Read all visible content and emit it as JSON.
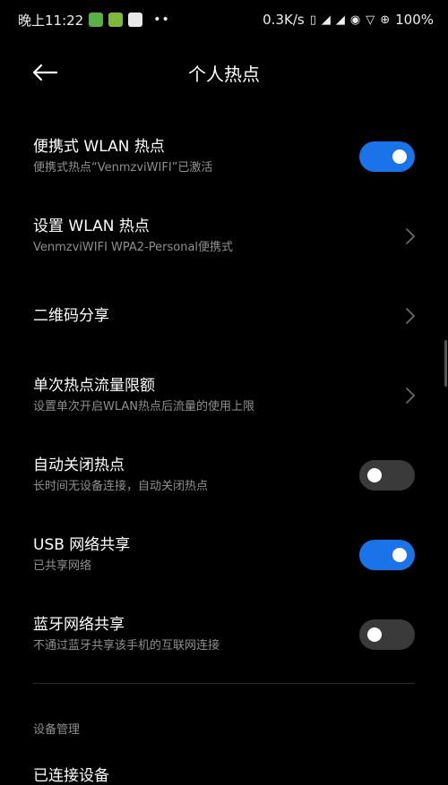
{
  "status_bar": {
    "time": "晚上11:22",
    "net_speed": "0.3K/s",
    "battery": "100%",
    "app_icons": [
      "wechat-like-icon",
      "android-app-icon",
      "check-app-icon"
    ],
    "system_icons": [
      "vibrate-icon",
      "signal-icon",
      "signal-icon",
      "hotspot-icon",
      "wifi-icon",
      "data-saver-icon"
    ]
  },
  "header": {
    "title": "个人热点"
  },
  "items": [
    {
      "label": "便携式 WLAN 热点",
      "sub": "便携式热点“VenmzviWIFI”已激活",
      "control": "toggle",
      "checked": true
    },
    {
      "label": "设置 WLAN 热点",
      "sub": "VenmzviWIFI WPA2-Personal便携式",
      "control": "chevron"
    },
    {
      "label": "二维码分享",
      "sub": "",
      "control": "chevron"
    },
    {
      "label": "单次热点流量限额",
      "sub": "设置单次开启WLAN热点后流量的使用上限",
      "control": "chevron"
    },
    {
      "label": "自动关闭热点",
      "sub": "长时间无设备连接，自动关闭热点",
      "control": "toggle",
      "checked": false
    },
    {
      "label": "USB 网络共享",
      "sub": "已共享网络",
      "control": "toggle",
      "checked": true
    },
    {
      "label": "蓝牙网络共享",
      "sub": "不通过蓝牙共享该手机的互联网连接",
      "control": "toggle",
      "checked": false
    }
  ],
  "section": {
    "label": "设备管理",
    "next_item_label": "已连接设备"
  },
  "colors": {
    "background": "#000000",
    "toggle_on": "#1a73e8",
    "toggle_off": "#3a3a3a",
    "secondary_text": "#8f8f8f"
  }
}
